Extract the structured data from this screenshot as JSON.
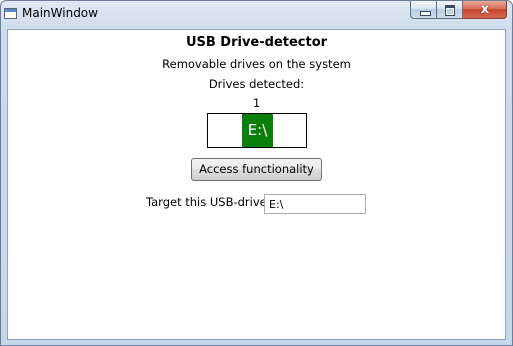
{
  "window": {
    "title": "MainWindow",
    "close_glyph": "x"
  },
  "main": {
    "heading": "USB Drive-detector",
    "subtitle": "Removable drives on the system",
    "detected_label": "Drives detected:",
    "detected_count": "1",
    "drives": [
      {
        "label": "E:\\",
        "color": "#0a7f0a"
      }
    ],
    "access_button_label": "Access functionality",
    "target_label": "Target this USB-drive:",
    "target_value": "E:\\"
  }
}
